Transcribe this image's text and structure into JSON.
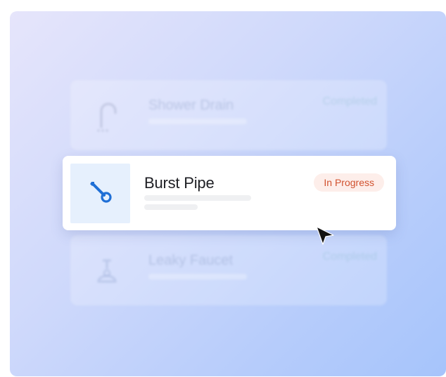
{
  "focused_card": {
    "title": "Burst Pipe",
    "status": "In Progress",
    "icon": "wrench-icon"
  },
  "background_cards": [
    {
      "title": "Shower Drain",
      "status": "Completed",
      "icon": "shower-icon"
    },
    {
      "title": "Leaky Faucet",
      "status": "Completed",
      "icon": "faucet-icon"
    }
  ],
  "colors": {
    "accent_blue": "#1f6fd6",
    "badge_text": "#d1522f",
    "badge_bg": "#fdeeea",
    "gradient_start": "#e6e5fb",
    "gradient_end": "#a6c4fb"
  }
}
